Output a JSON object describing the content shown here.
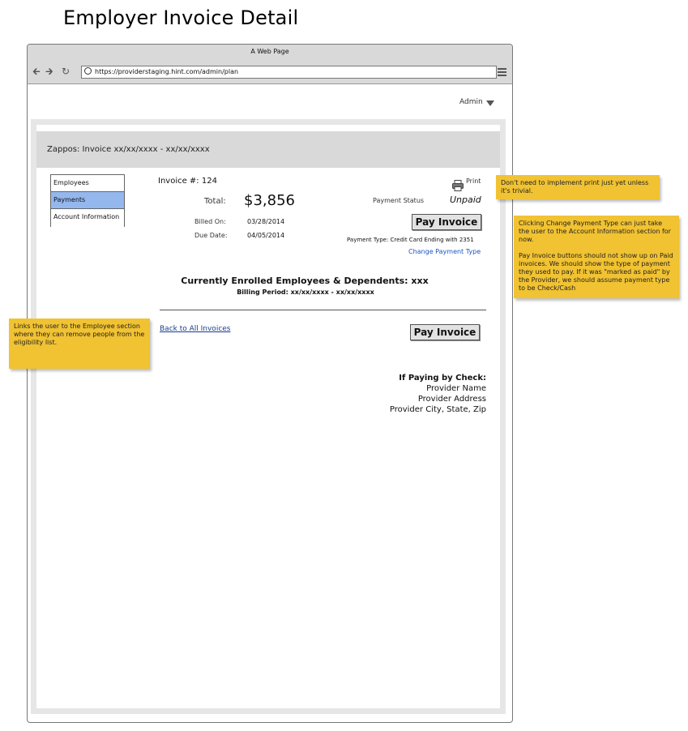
{
  "page": {
    "title": "Employer Invoice Detail"
  },
  "browser": {
    "window_title": "A Web Page",
    "url": "https://providerstaging.hint.com/admin/plan"
  },
  "header": {
    "user_menu": "Admin",
    "invoice_heading": "Zappos: Invoice xx/xx/xxxx - xx/xx/xxxx"
  },
  "sidebar": {
    "items": [
      {
        "label": "Employees",
        "active": false
      },
      {
        "label": "Payments",
        "active": true
      },
      {
        "label": "Account Information",
        "active": false
      }
    ]
  },
  "invoice": {
    "number": "Invoice #: 124",
    "print_label": "Print",
    "total_label": "Total:",
    "total_value": "$3,856",
    "billed_on_label": "Billed On:",
    "billed_on_value": "03/28/2014",
    "due_date_label": "Due Date:",
    "due_date_value": "04/05/2014",
    "payment_status_label": "Payment Status",
    "payment_status_value": "Unpaid",
    "pay_button": "Pay Invoice",
    "payment_type": "Payment Type:  Credit Card Ending with 2351",
    "change_payment_type": "Change Payment Type",
    "enrolled_heading": "Currently Enrolled Employees & Dependents: xxx",
    "billing_period": "Billing Period: xx/xx/xxxx - xx/xx/xxxx",
    "back_link": "Back to All Invoices",
    "pay_button_bottom": "Pay Invoice"
  },
  "check_info": {
    "heading": "If Paying by Check:",
    "name": "Provider Name",
    "address": "Provider Address",
    "city": "Provider City, State, Zip"
  },
  "notes": {
    "print": "Don't need to implement print just yet unless it's trivial.",
    "change_payment_1": "Clicking Change Payment Type can just take the user to the Account Information section for now.",
    "change_payment_2": "Pay Invoice buttons should not show up on Paid invoices. We should show the type of payment they used to pay. If it was \"marked as paid\" by the Provider, we should assume payment type to be Check/Cash",
    "employees_link": "Links the user to the Employee section where they can remove people from the eligibility list."
  },
  "colors": {
    "sticky_note": "#f1c232",
    "active_nav": "#94b7ee",
    "link": "#1a55c8"
  }
}
